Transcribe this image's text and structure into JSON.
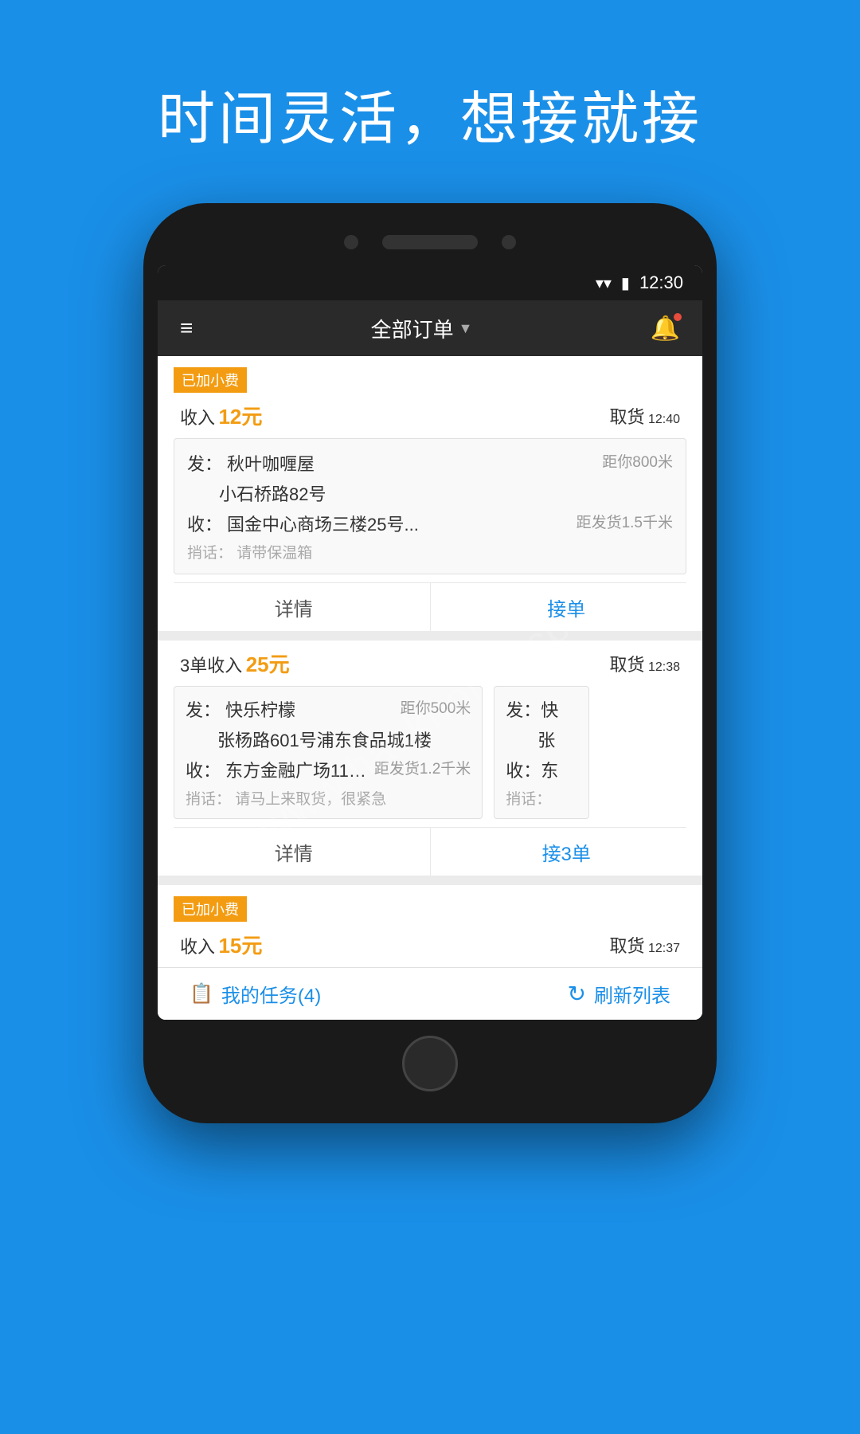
{
  "watermark": "www.hackhome.com",
  "heading": "时间灵活，想接就接",
  "status_bar": {
    "time": "12:30"
  },
  "app_header": {
    "menu_icon": "≡",
    "title": "全部订单",
    "title_arrow": "▼",
    "bell_icon": "🔔"
  },
  "order1": {
    "tag": "已加小费",
    "income_label": "收入",
    "income_amount": "12元",
    "pickup_label": "取货",
    "pickup_time": "12:40",
    "from_label": "发：",
    "from_name": "秋叶咖喱屋",
    "from_distance": "距你800米",
    "from_address": "小石桥路82号",
    "to_label": "收：",
    "to_name": "国金中心商场三楼25号...",
    "to_distance": "距发货1.5千米",
    "note_label": "捎话：",
    "note": "请带保温箱",
    "btn_detail": "详情",
    "btn_accept": "接单"
  },
  "order2": {
    "income_prefix": "3单收入",
    "income_amount": "25元",
    "pickup_label": "取货",
    "pickup_time": "12:38",
    "card1": {
      "from_label": "发：",
      "from_name": "快乐柠檬",
      "from_distance": "距你500米",
      "from_address": "张杨路601号浦东食品城1楼",
      "to_label": "收：",
      "to_name": "东方金融广场11…",
      "to_distance": "距发货1.2千米",
      "note_label": "捎话：",
      "note": "请马上来取货，很紧急"
    },
    "card2": {
      "from_label": "发：快",
      "from_address": "张",
      "to_label": "收：东",
      "note_label": "捎话："
    },
    "btn_detail": "详情",
    "btn_accept": "接3单"
  },
  "order3": {
    "tag": "已加小费",
    "income_label": "收入",
    "income_amount": "15元",
    "pickup_label": "取货",
    "pickup_time": "12:37"
  },
  "bottom_bar": {
    "my_tasks_label": "我的任务(4)",
    "refresh_label": "刷新列表"
  }
}
